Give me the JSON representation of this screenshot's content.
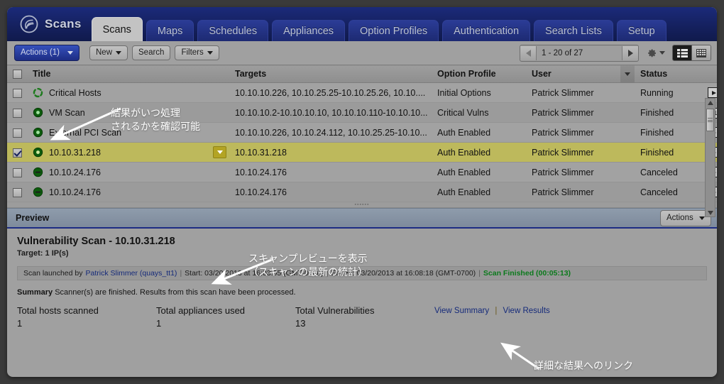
{
  "app": {
    "brand": "Scans",
    "brand_logo_icon": "scan-swirl-logo-icon"
  },
  "tabs": [
    {
      "label": "Scans",
      "active": true
    },
    {
      "label": "Maps",
      "active": false
    },
    {
      "label": "Schedules",
      "active": false
    },
    {
      "label": "Appliances",
      "active": false
    },
    {
      "label": "Option Profiles",
      "active": false
    },
    {
      "label": "Authentication",
      "active": false
    },
    {
      "label": "Search Lists",
      "active": false
    },
    {
      "label": "Setup",
      "active": false
    }
  ],
  "toolbar": {
    "actions_label": "Actions (1)",
    "new_label": "New",
    "search_label": "Search",
    "filters_label": "Filters",
    "pager_text": "1 - 20 of 27",
    "prev_icon": "triangle-left-icon",
    "next_icon": "triangle-right-icon",
    "gear_icon": "gear-icon",
    "gear_caret_icon": "chevron-down-icon",
    "view_list_icon": "list-view-icon",
    "view_grid_icon": "grid-view-icon"
  },
  "table": {
    "select_all_checked": false,
    "sort_column": "User",
    "sort_caret_icon": "chevron-down-icon",
    "columns": [
      "Title",
      "Targets",
      "Option Profile",
      "User",
      "Status"
    ],
    "rows": [
      {
        "checked": false,
        "status_icon": "spinner-running-icon",
        "title": "Critical Hosts",
        "targets": "10.10.10.226, 10.10.25.25-10.10.25.26, 10.10....",
        "option_profile": "Initial Options",
        "user": "Patrick Slimmer",
        "status": "Running",
        "action_icon": "play-action-icon",
        "selected": false
      },
      {
        "checked": false,
        "status_icon": "finished-dot-icon",
        "title": "VM Scan",
        "targets": "10.10.10.2-10.10.10.10, 10.10.10.110-10.10.10...",
        "option_profile": "Critical Vulns",
        "user": "Patrick Slimmer",
        "status": "Finished",
        "action_icon": "calendar-31-icon",
        "selected": false
      },
      {
        "checked": false,
        "status_icon": "finished-dot-icon",
        "title": "External PCI Scan",
        "targets": "10.10.10.226, 10.10.24.112, 10.10.25.25-10.10...",
        "option_profile": "Auth Enabled",
        "user": "Patrick Slimmer",
        "status": "Finished",
        "action_icon": "play-action-icon",
        "selected": false
      },
      {
        "checked": true,
        "status_icon": "finished-dot-icon",
        "title": "10.10.31.218",
        "targets": "10.10.31.218",
        "option_profile": "Auth Enabled",
        "user": "Patrick Slimmer",
        "status": "Finished",
        "action_icon": "play-action-icon",
        "selected": true,
        "row_menu_icon": "chevron-down-icon"
      },
      {
        "checked": false,
        "status_icon": "canceled-minus-icon",
        "title": "10.10.24.176",
        "targets": "10.10.24.176",
        "option_profile": "Auth Enabled",
        "user": "Patrick Slimmer",
        "status": "Canceled",
        "action_icon": "play-action-icon",
        "selected": false
      },
      {
        "checked": false,
        "status_icon": "canceled-minus-icon",
        "title": "10.10.24.176",
        "targets": "10.10.24.176",
        "option_profile": "Auth Enabled",
        "user": "Patrick Slimmer",
        "status": "Canceled",
        "action_icon": "play-action-icon",
        "selected": false
      }
    ],
    "scrollbar": {
      "up_icon": "scroll-up-arrow-icon",
      "down_icon": "scroll-down-arrow-icon"
    }
  },
  "preview": {
    "title": "Preview",
    "actions_label": "Actions",
    "actions_caret_icon": "chevron-down-icon",
    "scan_title": "Vulnerability Scan - 10.10.31.218",
    "target_label": "Target:",
    "target_value": "1 IP(s)",
    "launch": {
      "prefix": "Scan launched by",
      "user_link": "Patrick Slimmer (quays_tt1)",
      "separator": "|",
      "start": "Start: 03/20/2013 at 16:03:05 (GMT-0700)",
      "ended": "Ended: 03/20/2013 at 16:08:18 (GMT-0700)",
      "result": "Scan Finished (00:05:13)",
      "result_color": "#0b7a1c"
    },
    "summary_label": "Summary",
    "summary_text": "Scanner(s) are finished. Results from this scan have been processed.",
    "stats": [
      {
        "label": "Total hosts scanned",
        "value": "1"
      },
      {
        "label": "Total appliances used",
        "value": "1"
      },
      {
        "label": "Total Vulnerabilities",
        "value": "13"
      }
    ],
    "view_summary_label": "View Summary",
    "links_separator": "|",
    "view_results_label": "View Results"
  },
  "annotations": [
    {
      "text": "結果がいつ処理\nされるかを確認可能",
      "name": "annotation-status-icons"
    },
    {
      "text": "スキャンプレビューを表示\n（スキャンの最新の統計）",
      "name": "annotation-scan-preview"
    },
    {
      "text": "詳細な結果へのリンク",
      "name": "annotation-view-results"
    }
  ]
}
